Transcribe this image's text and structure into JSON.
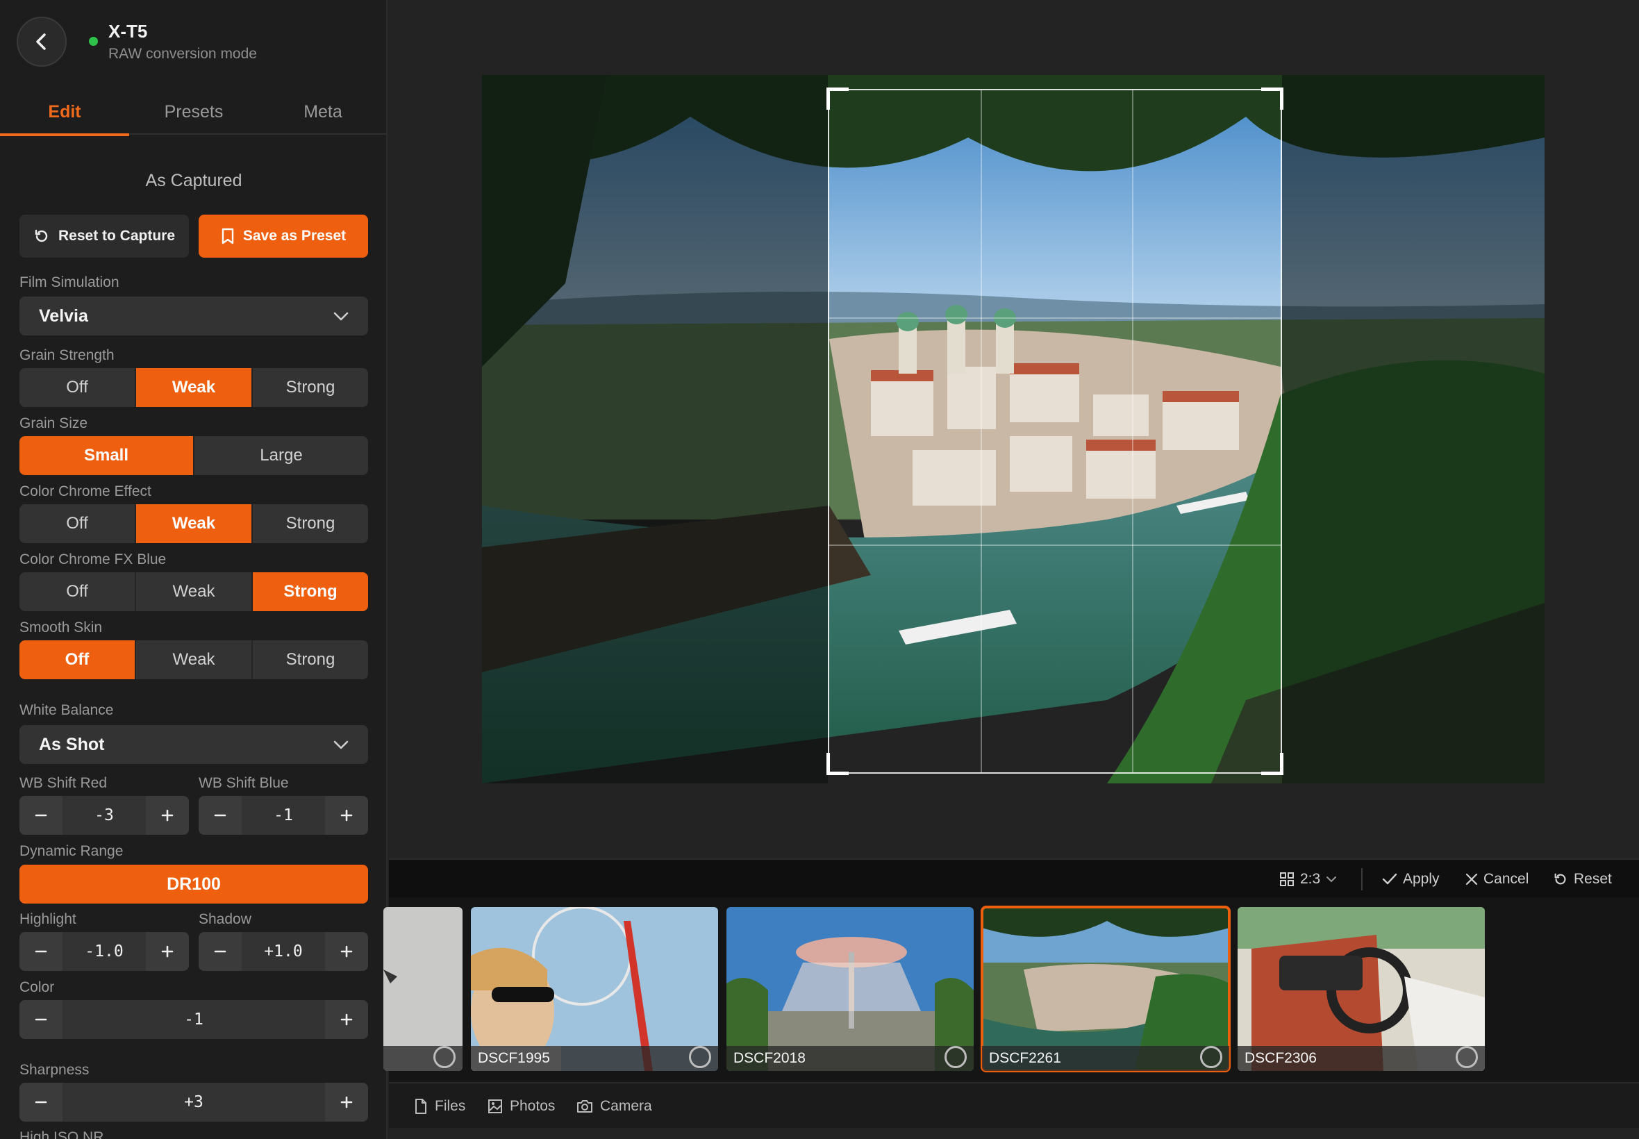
{
  "header": {
    "camera_name": "X-T5",
    "mode": "RAW conversion mode"
  },
  "tabs": [
    {
      "label": "Edit"
    },
    {
      "label": "Presets"
    },
    {
      "label": "Meta"
    }
  ],
  "preset": {
    "name": "As Captured",
    "reset_label": "Reset to Capture",
    "save_label": "Save as Preset"
  },
  "film_simulation": {
    "label": "Film Simulation",
    "value": "Velvia"
  },
  "grain_strength": {
    "label": "Grain Strength",
    "options": [
      "Off",
      "Weak",
      "Strong"
    ],
    "selected": "Weak"
  },
  "grain_size": {
    "label": "Grain Size",
    "options": [
      "Small",
      "Large"
    ],
    "selected": "Small"
  },
  "color_chrome": {
    "label": "Color Chrome Effect",
    "options": [
      "Off",
      "Weak",
      "Strong"
    ],
    "selected": "Weak"
  },
  "color_chrome_blue": {
    "label": "Color Chrome FX Blue",
    "options": [
      "Off",
      "Weak",
      "Strong"
    ],
    "selected": "Strong"
  },
  "smooth_skin": {
    "label": "Smooth Skin",
    "options": [
      "Off",
      "Weak",
      "Strong"
    ],
    "selected": "Off"
  },
  "white_balance": {
    "label": "White Balance",
    "value": "As Shot"
  },
  "wb_shift_red": {
    "label": "WB Shift Red",
    "value": "-3"
  },
  "wb_shift_blue": {
    "label": "WB Shift Blue",
    "value": "-1"
  },
  "dynamic_range": {
    "label": "Dynamic Range",
    "value": "DR100"
  },
  "highlight": {
    "label": "Highlight",
    "value": "-1.0"
  },
  "shadow": {
    "label": "Shadow",
    "value": "+1.0"
  },
  "color": {
    "label": "Color",
    "value": "-1"
  },
  "sharpness": {
    "label": "Sharpness",
    "value": "+3"
  },
  "high_iso_nr": {
    "label": "High ISO NR"
  },
  "crop_toolbar": {
    "ratio": "2:3",
    "apply": "Apply",
    "cancel": "Cancel",
    "reset": "Reset"
  },
  "filmstrip": [
    {
      "name": "",
      "selected": false
    },
    {
      "name": "DSCF1995",
      "selected": false
    },
    {
      "name": "DSCF2018",
      "selected": false
    },
    {
      "name": "DSCF2261",
      "selected": true
    },
    {
      "name": "DSCF2306",
      "selected": false
    }
  ],
  "bottom_nav": {
    "files": "Files",
    "photos": "Photos",
    "camera": "Camera"
  },
  "colors": {
    "accent": "#ee5f10",
    "status_online": "#2fc24a"
  }
}
